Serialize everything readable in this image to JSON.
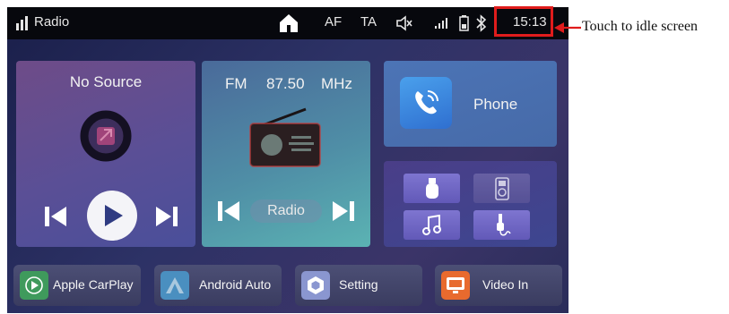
{
  "status_bar": {
    "app_title": "Radio",
    "af": "AF",
    "ta": "TA",
    "time": "15:13"
  },
  "source_panel": {
    "title": "No Source"
  },
  "radio_panel": {
    "band": "FM",
    "frequency": "87.50",
    "unit": "MHz",
    "label": "Radio"
  },
  "phone_panel": {
    "label": "Phone"
  },
  "media_tiles": [
    {
      "icon": "usb-icon"
    },
    {
      "icon": "ipod-icon"
    },
    {
      "icon": "music-note-icon"
    },
    {
      "icon": "aux-jack-icon"
    }
  ],
  "apps": [
    {
      "label": "Apple CarPlay",
      "icon": "carplay-icon",
      "color": "#3f9a5c"
    },
    {
      "label": "Android Auto",
      "icon": "android-auto-icon",
      "color": "#4a8fc0"
    },
    {
      "label": "Setting",
      "icon": "settings-hexagon-icon",
      "color": "#8a96d0"
    },
    {
      "label": "Video In",
      "icon": "video-in-icon",
      "color": "#e86a2e"
    }
  ],
  "annotation": {
    "text": "Touch to idle screen",
    "highlight_color": "#e01c1c"
  }
}
